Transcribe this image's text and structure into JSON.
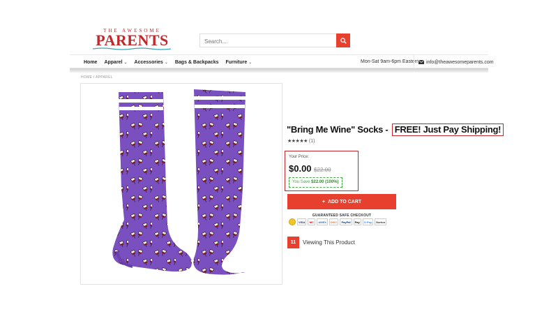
{
  "header": {
    "logo_top": "THE AWESOME",
    "logo_main": "PARENTS",
    "search_placeholder": "Search..."
  },
  "nav": {
    "items": [
      {
        "label": "Home",
        "dropdown": false
      },
      {
        "label": "Apparel",
        "dropdown": true
      },
      {
        "label": "Accessories",
        "dropdown": true
      },
      {
        "label": "Bags & Backpacks",
        "dropdown": false
      },
      {
        "label": "Furniture",
        "dropdown": true
      }
    ],
    "hours": "Mon-Sat 9am-6pm Eastern",
    "email": "info@theawesomeparents.com"
  },
  "breadcrumb": "HOME / APPAREL",
  "product": {
    "title": "\"Bring Me Wine\" Socks - ",
    "title_highlight": "FREE! Just Pay Shipping!",
    "stars": "★★★★★",
    "review_count": "(1)",
    "price_label": "Your Price:",
    "price": "$0.00",
    "old_price": "$22.00",
    "save_prefix": "You Save",
    "save_amount": "$22.00 (100%)",
    "add_to_cart": "ADD TO CART",
    "safe_checkout": "GUARANTEED SAFE CHECKOUT",
    "payment_methods": [
      "",
      "VISA",
      "MC",
      "AMEX",
      "DISC",
      "PayPal",
      "Pay",
      "G Pay",
      "Norton"
    ],
    "viewing_count": "11",
    "viewing_label": "Viewing This Product"
  },
  "colors": {
    "accent": "#e8402e",
    "brand": "#c0292c",
    "sock_purple": "#7a4fc0",
    "save_green": "#4aa84a"
  }
}
